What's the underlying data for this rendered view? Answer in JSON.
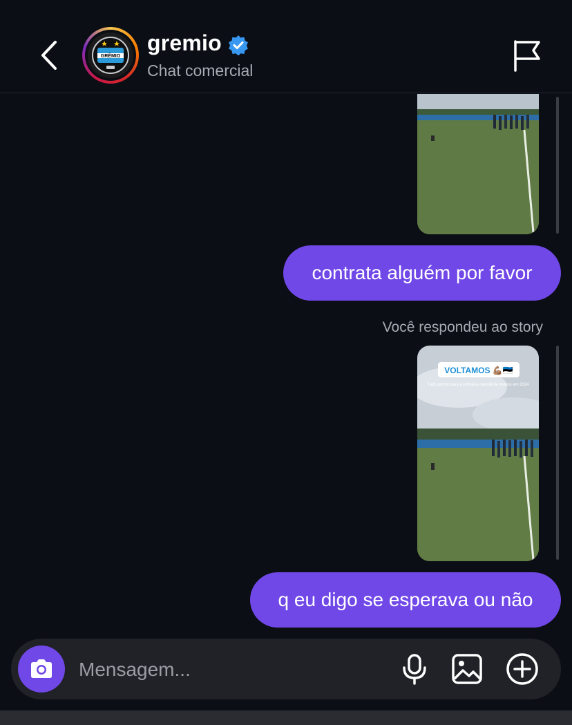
{
  "header": {
    "username": "gremio",
    "subtitle": "Chat comercial",
    "verified": true,
    "logo_text": "GRÊMIO"
  },
  "messages": [
    {
      "type": "story",
      "from": "me"
    },
    {
      "type": "text",
      "from": "me",
      "text": "contrata alguém por favor"
    },
    {
      "type": "story_reply_note",
      "text": "Você respondeu ao story"
    },
    {
      "type": "story",
      "from": "me",
      "banner": "VOLTAMOS 💪🏽🇪🇪",
      "caption": "Tudo pronto para a primeira manhã de treinos em 2024"
    },
    {
      "type": "text",
      "from": "me",
      "text": "q eu digo se esperava ou não"
    }
  ],
  "composer": {
    "placeholder": "Mensagem..."
  },
  "colors": {
    "background": "#0b0e14",
    "bubble": "#7148e8",
    "verified": "#3897f0",
    "muted_text": "#a8abb3"
  },
  "icons": [
    "back-chevron-icon",
    "verified-badge-icon",
    "flag-icon",
    "camera-icon",
    "microphone-icon",
    "image-icon",
    "plus-circle-icon"
  ]
}
